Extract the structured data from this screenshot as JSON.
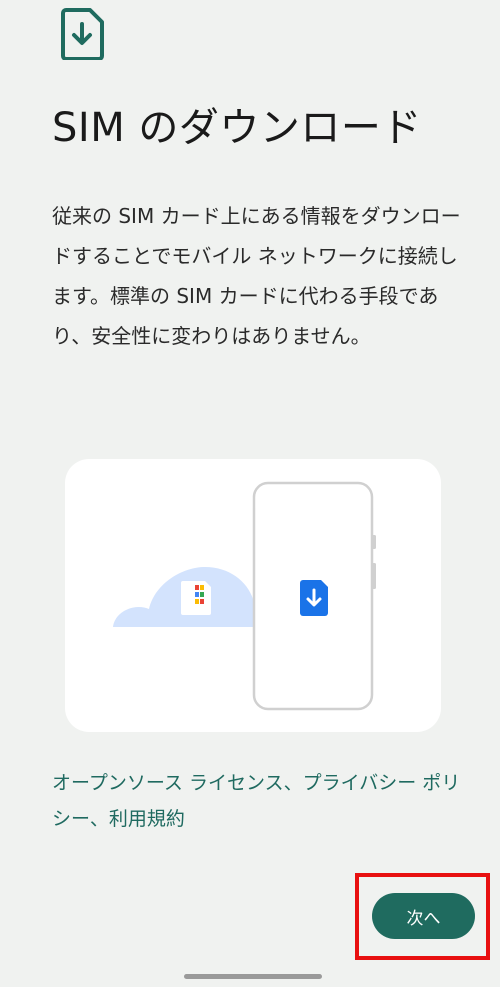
{
  "page": {
    "title": "SIM のダウンロード",
    "description": "従来の SIM カード上にある情報をダウンロードすることでモバイル ネットワークに接続します。標準の SIM カードに代わる手段であり、安全性に変わりはありません。"
  },
  "icons": {
    "header": "sim-download-icon",
    "illustration_sim": "sim-card-icon",
    "illustration_esim": "esim-download-icon",
    "cloud": "cloud-icon",
    "phone": "phone-outline-icon"
  },
  "links": {
    "open_source": "オープンソース ライセンス",
    "separator1": "、",
    "privacy": "プライバシー ポリシー",
    "separator2": "、",
    "terms": "利用規約"
  },
  "footer": {
    "next_label": "次へ"
  },
  "colors": {
    "accent": "#1f6b5f",
    "link": "#1f6a60",
    "background": "#f0f2f0",
    "highlight": "#e81010",
    "esim_blue": "#1a73e8",
    "cloud": "#d3e3fd"
  }
}
